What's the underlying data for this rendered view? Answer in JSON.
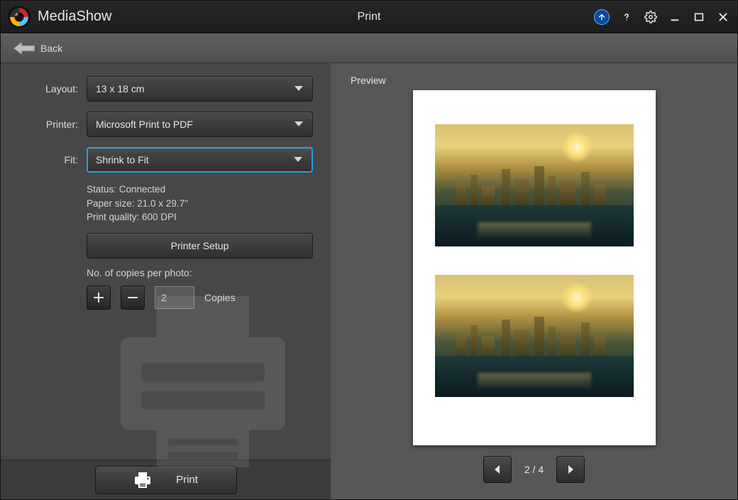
{
  "app": {
    "name": "MediaShow",
    "page_title": "Print"
  },
  "nav": {
    "back": "Back"
  },
  "form": {
    "layout_label": "Layout:",
    "layout_value": "13 x 18 cm",
    "printer_label": "Printer:",
    "printer_value": "Microsoft Print to PDF",
    "fit_label": "Fit:",
    "fit_value": "Shrink to Fit",
    "status_line": "Status: Connected",
    "paper_line": "Paper size: 21.0 x 29.7\"",
    "quality_line": "Print quality: 600 DPI",
    "printer_setup": "Printer Setup",
    "copies_label": "No. of copies per photo:",
    "copies_value": "2",
    "copies_unit": "Copies",
    "print_button": "Print"
  },
  "preview": {
    "label": "Preview",
    "page_indicator": "2 / 4"
  }
}
